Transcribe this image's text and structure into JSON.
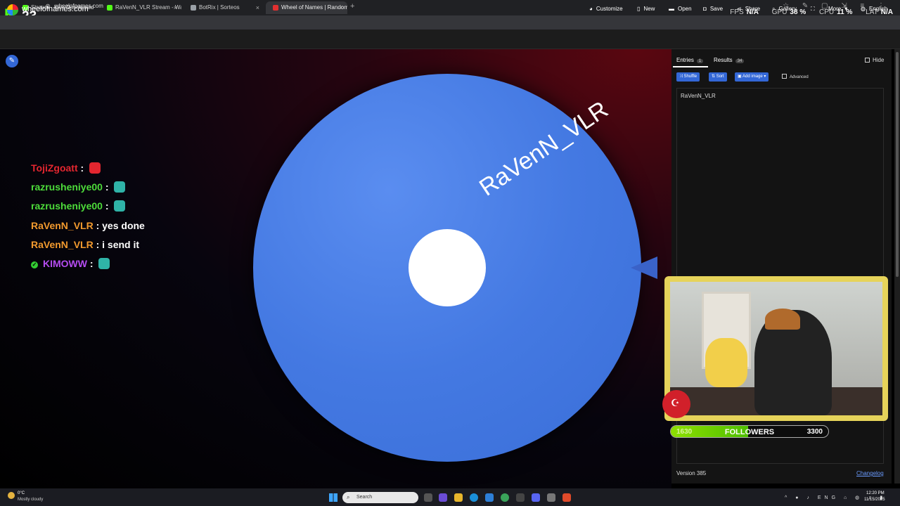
{
  "browser": {
    "stream_logo_number": "23",
    "tabs": [
      {
        "label": "Stream - Kick Dashboard",
        "fav_color": "#53fc18"
      },
      {
        "label": "RaVenN_VLR Stream - Watch Li",
        "fav_color": "#53fc18"
      },
      {
        "label": "BotRix | Sorteos",
        "fav_color": "#9aa0a6"
      },
      {
        "label": "Wheel of Names | Random nam",
        "fav_color": "#e23030"
      }
    ],
    "new_tab_icon": "+",
    "close_icon": "×",
    "url": "wheelofnames.com"
  },
  "perf": {
    "fps_label": "FPS",
    "fps_value": "N/A",
    "gpu_label": "GPU",
    "gpu_value": "38 %",
    "cpu_label": "CPU",
    "cpu_value": "11 %",
    "lat_label": "LAT",
    "lat_value": "N/A"
  },
  "site": {
    "name": "wheelofnames.com",
    "nav": [
      {
        "label": "Customize",
        "icon": "palette-icon"
      },
      {
        "label": "New",
        "icon": "file-icon"
      },
      {
        "label": "Open",
        "icon": "folder-icon"
      },
      {
        "label": "Save",
        "icon": "save-icon"
      },
      {
        "label": "Share",
        "icon": "share-icon"
      },
      {
        "label": "Gallery",
        "icon": "search-icon"
      },
      {
        "label": "",
        "icon": "fullscreen-icon"
      },
      {
        "label": "More",
        "icon": "chevron-down-icon"
      },
      {
        "label": "English",
        "icon": "globe-icon"
      }
    ]
  },
  "wheel": {
    "entry_label": "RaVenN_VLR",
    "color": "#4479e2"
  },
  "chat": [
    {
      "user": "TojiZgoatt",
      "text": ":",
      "color": "#e3262f",
      "emote_color": "#e3262f",
      "verified": false
    },
    {
      "user": "razrusheniye00",
      "text": ":",
      "color": "#4ddc3a",
      "emote_color": "#2fb3a7",
      "verified": false
    },
    {
      "user": "razrusheniye00",
      "text": ":",
      "color": "#4ddc3a",
      "emote_color": "#2fb3a7",
      "verified": false
    },
    {
      "user": "RaVenN_VLR",
      "text": ": yes done",
      "color": "#f29a2e",
      "emote_color": "",
      "verified": false
    },
    {
      "user": "RaVenN_VLR",
      "text": ": i send it",
      "color": "#f29a2e",
      "emote_color": "",
      "verified": false
    },
    {
      "user": "KIMOWW",
      "text": ":",
      "color": "#b44cf0",
      "emote_color": "#2fb3a7",
      "verified": true
    }
  ],
  "panel": {
    "tab_entries": "Entries",
    "entries_count": "1",
    "tab_results": "Results",
    "results_count": "34",
    "hide_label": "Hide",
    "buttons": {
      "shuffle": "Shuffle",
      "sort": "Sort",
      "add_image": "Add image"
    },
    "advanced_label": "Advanced",
    "entries_text": "RaVenN_VLR",
    "version": "Version 385",
    "changelog": "Changelog"
  },
  "overlay": {
    "followers_current": "1630",
    "followers_label": "FOLLOWERS",
    "followers_goal": "3300",
    "followers_progress": 0.49
  },
  "taskbar": {
    "weather_temp": "0°C",
    "weather_condition": "Mostly cloudy",
    "search_placeholder": "Search",
    "search_icon": "search-icon",
    "tray_lang": "ENG",
    "time": "12:20 PM",
    "date": "11/15/2025"
  }
}
